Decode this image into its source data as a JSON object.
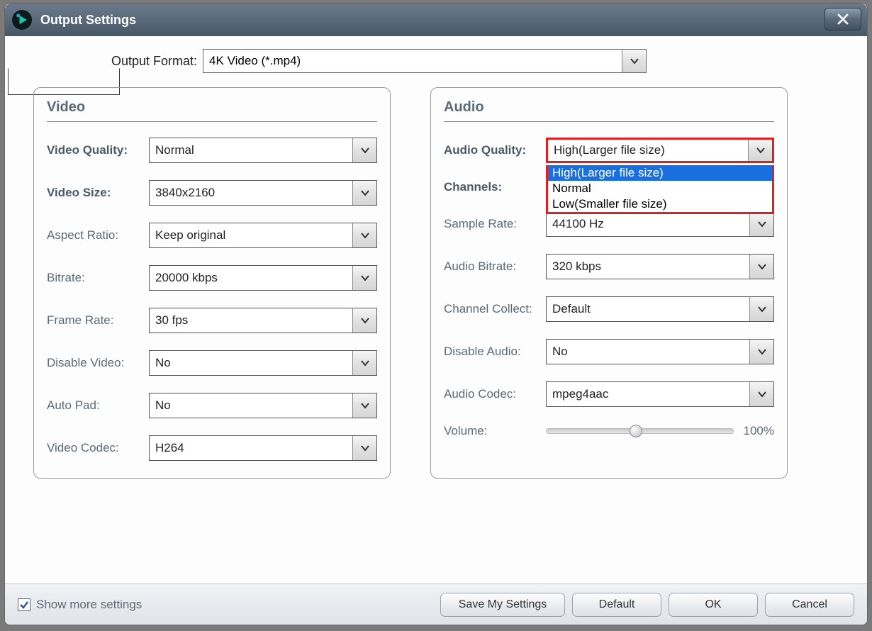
{
  "window": {
    "title": "Output Settings"
  },
  "outputFormat": {
    "label": "Output Format:",
    "value": "4K Video (*.mp4)"
  },
  "video": {
    "title": "Video",
    "quality": {
      "label": "Video Quality:",
      "value": "Normal"
    },
    "size": {
      "label": "Video Size:",
      "value": "3840x2160"
    },
    "aspect": {
      "label": "Aspect Ratio:",
      "value": "Keep original"
    },
    "bitrate": {
      "label": "Bitrate:",
      "value": "20000 kbps"
    },
    "framerate": {
      "label": "Frame Rate:",
      "value": "30 fps"
    },
    "disable": {
      "label": "Disable Video:",
      "value": "No"
    },
    "autopad": {
      "label": "Auto Pad:",
      "value": "No"
    },
    "codec": {
      "label": "Video Codec:",
      "value": "H264"
    }
  },
  "audio": {
    "title": "Audio",
    "quality": {
      "label": "Audio Quality:",
      "value": "High(Larger file size)",
      "options": [
        "High(Larger file size)",
        "Normal",
        "Low(Smaller file size)"
      ]
    },
    "channels": {
      "label": "Channels:"
    },
    "sampleRate": {
      "label": "Sample Rate:",
      "value": "44100 Hz"
    },
    "bitrate": {
      "label": "Audio Bitrate:",
      "value": "320 kbps"
    },
    "channelCollect": {
      "label": "Channel Collect:",
      "value": "Default"
    },
    "disable": {
      "label": "Disable Audio:",
      "value": "No"
    },
    "codec": {
      "label": "Audio Codec:",
      "value": "mpeg4aac"
    },
    "volume": {
      "label": "Volume:",
      "percent": 48,
      "display": "100%"
    }
  },
  "footer": {
    "showMore": "Show more settings",
    "save": "Save My Settings",
    "default": "Default",
    "ok": "OK",
    "cancel": "Cancel"
  }
}
